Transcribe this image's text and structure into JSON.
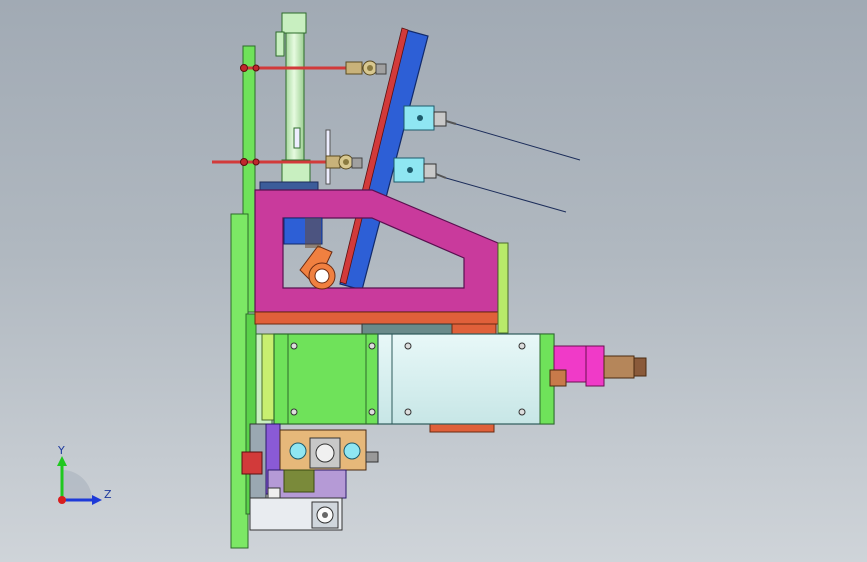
{
  "viewport": {
    "background_top": "#a1aab4",
    "background_bottom": "#cfd4d9"
  },
  "triad": {
    "y_label": "Y",
    "z_label": "Z",
    "y_color": "#1fc81f",
    "z_color": "#1e3ad8",
    "x_color": "#d81e1e"
  },
  "part_colors": {
    "frame_green": "#6fe25a",
    "cylinder": "#c8efc0",
    "bracket_magenta": "#c93a9c",
    "plate_blue": "#2d5fd6",
    "sensor_cyan": "#8fe6f2",
    "motor_body": "#d9f2f2",
    "motor_cap": "#f03ac8",
    "rod_red": "#d23a3a",
    "gear_orange": "#e0603a",
    "block_white": "#e9ecf0",
    "wire": "#1c2d5a"
  }
}
